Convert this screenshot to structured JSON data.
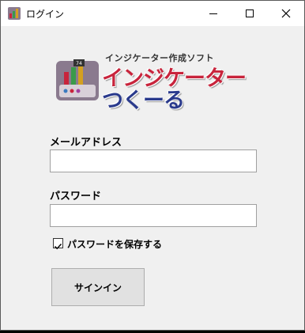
{
  "window": {
    "title": "ログイン"
  },
  "logo": {
    "subtitle": "インジケーター作成ソフト",
    "title_line1": "インジケーター",
    "title_line2": "つくーる",
    "badge": "74",
    "colors": {
      "red": "#c8243c",
      "navy": "#2a3a8c"
    }
  },
  "form": {
    "email_label": "メールアドレス",
    "email_value": "",
    "password_label": "パスワード",
    "password_value": "",
    "save_password_label": "パスワードを保存する",
    "save_password_checked": true,
    "signin_label": "サインイン"
  },
  "icons": [
    "app-icon",
    "minimize-icon",
    "maximize-icon",
    "close-icon",
    "check-icon"
  ]
}
